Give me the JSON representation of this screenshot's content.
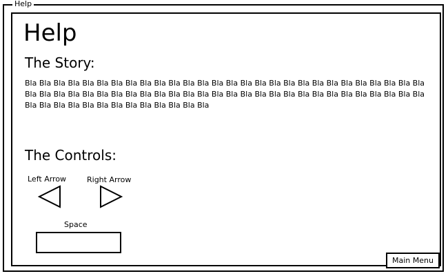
{
  "window": {
    "title": "Help"
  },
  "page": {
    "heading": "Help"
  },
  "story": {
    "title": "The Story:",
    "text": "Bla Bla Bla Bla Bla Bla Bla Bla Bla Bla Bla Bla Bla Bla Bla Bla Bla Bla Bla Bla Bla Bla Bla Bla Bla Bla Bla Bla Bla Bla Bla Bla Bla Bla Bla Bla Bla Bla Bla Bla Bla Bla Bla Bla Bla Bla Bla Bla Bla Bla Bla Bla Bla Bla Bla Bla Bla Bla Bla Bla Bla Bla Bla Bla Bla Bla Bla Bla Bla"
  },
  "controls": {
    "title": "The Controls:",
    "left_arrow_label": "Left Arrow",
    "right_arrow_label": "Right Arrow",
    "space_label": "Space",
    "left_icon": "left-triangle-icon",
    "right_icon": "right-triangle-icon"
  },
  "footer": {
    "main_menu_label": "Main Menu"
  }
}
